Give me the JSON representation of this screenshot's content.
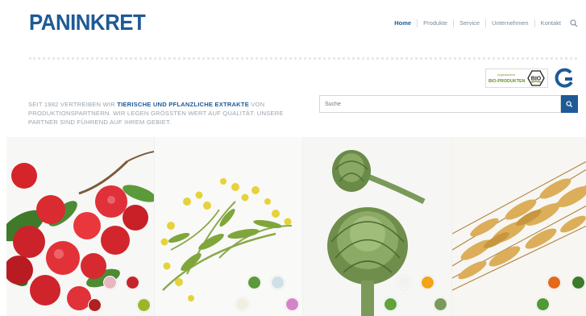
{
  "brand": {
    "logo_text": "PANINKRET"
  },
  "nav": {
    "items": [
      {
        "label": "Home",
        "active": true
      },
      {
        "label": "Produkte",
        "active": false
      },
      {
        "label": "Service",
        "active": false
      },
      {
        "label": "Unternehmen",
        "active": false
      },
      {
        "label": "Kontakt",
        "active": false
      }
    ],
    "search_icon": "search-icon"
  },
  "badges": {
    "bio_small": "zugelassene",
    "bio_label": "BIO-PRODUKTEN",
    "bio_mark": "BIO"
  },
  "intro": {
    "part1": "SEIT 1982 VERTREIBEN WIR ",
    "highlight": "TIERISCHE UND PFLANZLICHE EXTRAKTE",
    "part2": " VON PRODUKTIONSPARTNERN. WIR LEGEN GRÖßTEN WERT AUF QUALITÄT. UNSERE PARTNER SIND FÜHREND AUF IHREM GEBIET."
  },
  "search": {
    "placeholder": "Suche",
    "value": ""
  },
  "colors": {
    "brand_blue": "#1e5a96",
    "text_grey": "#9aa4ae",
    "nav_grey": "#7a8a9a"
  },
  "tiles": [
    {
      "subject": "acerola-cherries",
      "thumbs": 4
    },
    {
      "subject": "tansy-herb",
      "thumbs": 4
    },
    {
      "subject": "artichokes",
      "thumbs": 4
    },
    {
      "subject": "wheat-ears",
      "thumbs": 3
    }
  ]
}
